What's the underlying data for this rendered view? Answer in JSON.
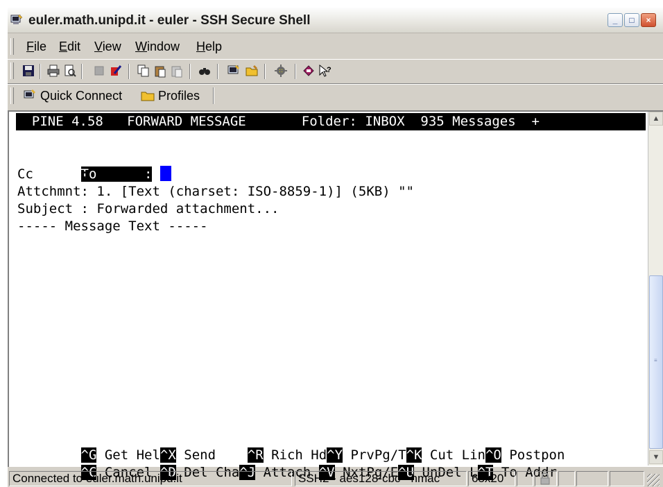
{
  "window": {
    "title": "euler.math.unipd.it - euler - SSH Secure Shell",
    "controls": [
      "minimize",
      "maximize",
      "close"
    ]
  },
  "menu": [
    {
      "label": "File"
    },
    {
      "label": "Edit"
    },
    {
      "label": "View"
    },
    {
      "label": "Window"
    },
    {
      "label": "Help"
    }
  ],
  "toolbar": {
    "icons": [
      "save-icon",
      "print-icon",
      "print-preview-icon",
      "disconnect-icon",
      "delete-icon",
      "copy-icon",
      "paste-icon",
      "paste-alt-icon",
      "find-icon",
      "new-terminal-icon",
      "new-file-transfer-icon",
      "settings-icon",
      "help-topics-icon",
      "whats-this-icon"
    ]
  },
  "quickbar": {
    "quick_connect": "Quick Connect",
    "profiles": "Profiles"
  },
  "terminal": {
    "header": "  PINE 4.58   FORWARD MESSAGE       Folder: INBOX  935 Messages  +",
    "to_label": "To      :",
    "cc_line": "Cc      :",
    "attach_line": "Attchmnt: 1. [Text (charset: ISO-8859-1)] (5KB) \"\"",
    "subject_line": "Subject : Forwarded attachment...",
    "message_text_line": "----- Message Text -----",
    "commands_row1": [
      {
        "key": "^G",
        "label": " Get Hel"
      },
      {
        "key": "^X",
        "label": " Send    "
      },
      {
        "key": "^R",
        "label": " Rich Hd"
      },
      {
        "key": "^Y",
        "label": " PrvPg/T"
      },
      {
        "key": "^K",
        "label": " Cut Lin"
      },
      {
        "key": "^O",
        "label": " Postpon"
      }
    ],
    "commands_row2": [
      {
        "key": "^C",
        "label": " Cancel "
      },
      {
        "key": "^D",
        "label": " Del Cha"
      },
      {
        "key": "^J",
        "label": " Attach "
      },
      {
        "key": "^V",
        "label": " NxtPg/E"
      },
      {
        "key": "^U",
        "label": " UnDel L"
      },
      {
        "key": "^T",
        "label": " To Addr"
      }
    ]
  },
  "status": {
    "connection": "Connected to euler.math.unipd.it",
    "cipher": "SSH2 - aes128-cbc - hmac",
    "size": "65x20"
  },
  "colors": {
    "terminal_bg": "#ffffff",
    "terminal_fg": "#000000",
    "cursor": "#0000ff",
    "chrome": "#d4d0c8"
  }
}
